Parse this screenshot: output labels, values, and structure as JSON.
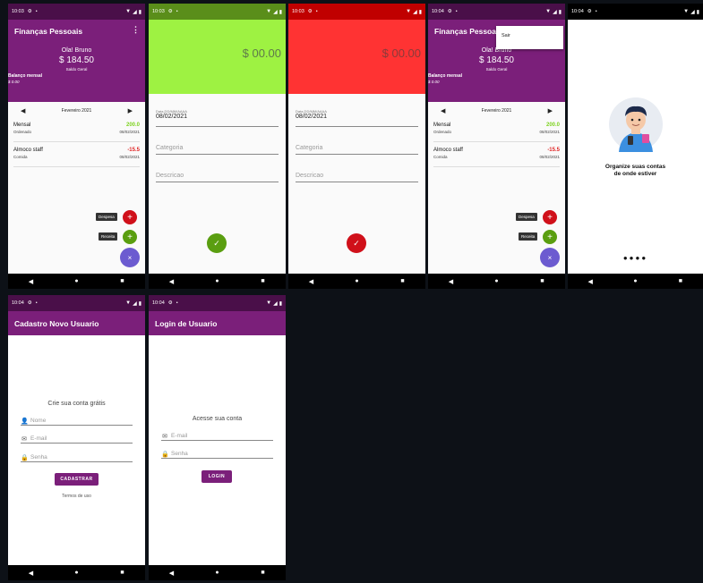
{
  "nav": {
    "back": "◀",
    "home": "●",
    "recents": "■"
  },
  "screens": {
    "home": {
      "time": "10:03",
      "title": "Finanças Pessoais",
      "greeting": "Ola! Bruno",
      "amount": "$ 184.50",
      "subtitle": "Saldo Geral",
      "balance_label": "Balanço mensal",
      "balance_value": "$ 0.00",
      "month": "Fevereiro 2021",
      "transactions": [
        {
          "name": "Mensal",
          "category": "Ordenado",
          "value": "200.0",
          "date": "08/02/2021",
          "color": "#7ed321"
        },
        {
          "name": "Almoco staff",
          "category": "Comida",
          "value": "-15.5",
          "date": "08/02/2021",
          "color": "#e02020"
        }
      ],
      "despesa_label": "Despesa",
      "receita_label": "Receita"
    },
    "income": {
      "time": "10:03",
      "amount": "$ 00.00",
      "date_label": "Data DD/MM/AAAA",
      "date_value": "08/02/2021",
      "category_placeholder": "Categoria",
      "description_placeholder": "Descricao",
      "accent": "#9ef242"
    },
    "expense": {
      "time": "10:03",
      "amount": "$ 00.00",
      "date_label": "Data DD/MM/AAAA",
      "date_value": "08/02/2021",
      "category_placeholder": "Categoria",
      "description_placeholder": "Descricao",
      "accent": "#ff3333"
    },
    "menu": {
      "time": "10:04",
      "logout": "Sair"
    },
    "onboarding": {
      "time": "10:04",
      "text_line1": "Organize suas contas",
      "text_line2": "de onde estiver"
    },
    "register": {
      "time": "10:04",
      "title": "Cadastro Novo Usuario",
      "heading": "Crie sua conta grátis",
      "name_placeholder": "Nome",
      "email_placeholder": "E-mail",
      "password_placeholder": "Senha",
      "button": "CADASTRAR",
      "terms": "Termos de uso"
    },
    "login": {
      "time": "10:04",
      "title": "Login de Usuario",
      "heading": "Acesse sua conta",
      "email_placeholder": "E-mail",
      "password_placeholder": "Senha",
      "button": "LOGIN"
    }
  }
}
